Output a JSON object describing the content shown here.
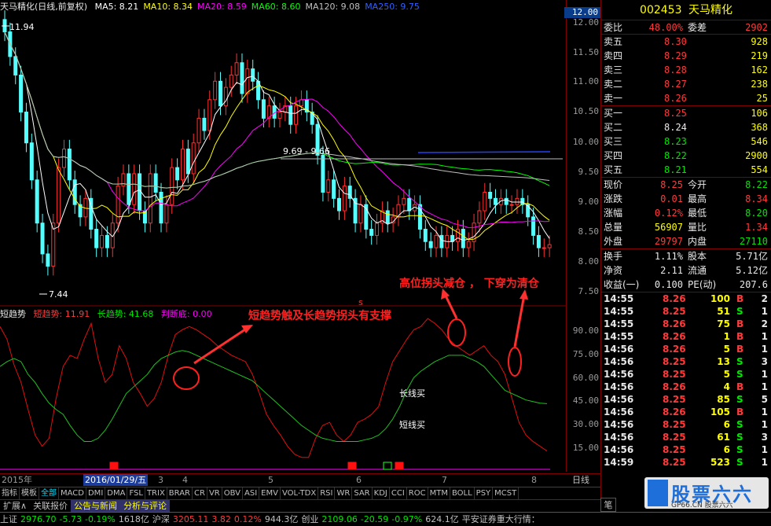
{
  "stock": {
    "code": "002453",
    "name": "天马精化"
  },
  "chart_header": {
    "title": "天马精化(日线,前复权)",
    "ma": [
      {
        "label": "MA5: 8.21",
        "color": "#ffffff"
      },
      {
        "label": "MA10: 8.34",
        "color": "#ffff00"
      },
      {
        "label": "MA20: 8.59",
        "color": "#ff00ff"
      },
      {
        "label": "MA60: 8.60",
        "color": "#00ff00"
      },
      {
        "label": "MA120: 9.08",
        "color": "#c0c0c0"
      },
      {
        "label": "MA250: 9.75",
        "color": "#3060ff"
      }
    ]
  },
  "price_axis": [
    "12.00",
    "11.50",
    "11.00",
    "10.50",
    "10.00",
    "9.50",
    "9.00",
    "8.50",
    "8.00",
    "7.50"
  ],
  "current_price_box": "12.00",
  "price_marks": {
    "high": "11.94",
    "low": "7.44",
    "level": "9.69 - 9.66"
  },
  "indicator_header": {
    "name": "短趋势",
    "short": "短趋势: 11.91",
    "long": "长趋势: 41.68",
    "judge": "判断底: 0.00"
  },
  "indicator_axis": [
    "90.00",
    "75.00",
    "60.00",
    "45.00",
    "30.00",
    "15.00"
  ],
  "annotations": {
    "a1": "短趋势触及长趋势拐头有支撑",
    "a2": "高位拐头减仓 ， 下穿为清仓",
    "long_buy": "长线买",
    "short_buy": "短线买",
    "marker": "s"
  },
  "date_axis": {
    "year": "2015年",
    "selected": "2016/01/29/五",
    "months": [
      "3",
      "4",
      "5",
      "6",
      "7",
      "8"
    ],
    "period": "日线"
  },
  "tabs": [
    "指标",
    "模板",
    "全部",
    "MACD",
    "DMI",
    "DMA",
    "FSL",
    "TRIX",
    "BRAR",
    "CR",
    "VR",
    "OBV",
    "ASI",
    "EMV",
    "VOL-TDX",
    "RSI",
    "WR",
    "SAR",
    "KDJ",
    "CCI",
    "ROC",
    "MTM",
    "BOLL",
    "PSY",
    "MCST"
  ],
  "subtabs": [
    "扩展∧",
    "关联报价",
    "公告与新闻",
    "分析与评论"
  ],
  "order_book": {
    "wb_label": "委比",
    "wb_value": "48.00%",
    "wc_label": "委差",
    "wc_value": "2902",
    "sell": [
      {
        "label": "卖五",
        "price": "8.30",
        "vol": "928"
      },
      {
        "label": "卖四",
        "price": "8.29",
        "vol": "219"
      },
      {
        "label": "卖三",
        "price": "8.28",
        "vol": "162"
      },
      {
        "label": "卖二",
        "price": "8.27",
        "vol": "238"
      },
      {
        "label": "卖一",
        "price": "8.26",
        "vol": "25"
      }
    ],
    "buy": [
      {
        "label": "买一",
        "price": "8.25",
        "vol": "106"
      },
      {
        "label": "买二",
        "price": "8.24",
        "vol": "368"
      },
      {
        "label": "买三",
        "price": "8.23",
        "vol": "546"
      },
      {
        "label": "买四",
        "price": "8.22",
        "vol": "2900"
      },
      {
        "label": "买五",
        "price": "8.21",
        "vol": "554"
      }
    ]
  },
  "quote": [
    {
      "l1": "现价",
      "v1": "8.25",
      "c1": "red",
      "l2": "今开",
      "v2": "8.22",
      "c2": "green"
    },
    {
      "l1": "涨跌",
      "v1": "0.01",
      "c1": "red",
      "l2": "最高",
      "v2": "8.34",
      "c2": "red"
    },
    {
      "l1": "涨幅",
      "v1": "0.12%",
      "c1": "red",
      "l2": "最低",
      "v2": "8.20",
      "c2": "green"
    },
    {
      "l1": "总量",
      "v1": "56907",
      "c1": "yellow",
      "l2": "量比",
      "v2": "1.34",
      "c2": "red"
    },
    {
      "l1": "外盘",
      "v1": "29797",
      "c1": "red",
      "l2": "内盘",
      "v2": "27110",
      "c2": "green"
    }
  ],
  "quote2": [
    {
      "l1": "换手",
      "v1": "1.11%",
      "l2": "股本",
      "v2": "5.71亿"
    },
    {
      "l1": "净资",
      "v1": "2.11",
      "l2": "流通",
      "v2": "5.12亿"
    },
    {
      "l1": "收益(一)",
      "v1": "0.100",
      "l2": "PE(动)",
      "v2": "207.6"
    }
  ],
  "ticks": [
    {
      "t": "14:55",
      "p": "8.26",
      "v": "100",
      "s": "B",
      "n": "2"
    },
    {
      "t": "14:55",
      "p": "8.25",
      "v": "51",
      "s": "S",
      "n": "1"
    },
    {
      "t": "14:55",
      "p": "8.26",
      "v": "75",
      "s": "B",
      "n": "2"
    },
    {
      "t": "14:55",
      "p": "8.26",
      "v": "1",
      "s": "B",
      "n": "1"
    },
    {
      "t": "14:56",
      "p": "8.26",
      "v": "5",
      "s": "B",
      "n": "1"
    },
    {
      "t": "14:56",
      "p": "8.25",
      "v": "13",
      "s": "S",
      "n": "3"
    },
    {
      "t": "14:56",
      "p": "8.25",
      "v": "5",
      "s": "S",
      "n": "1"
    },
    {
      "t": "14:56",
      "p": "8.26",
      "v": "4",
      "s": "B",
      "n": "1"
    },
    {
      "t": "14:56",
      "p": "8.25",
      "v": "85",
      "s": "S",
      "n": "5"
    },
    {
      "t": "14:56",
      "p": "8.26",
      "v": "105",
      "s": "B",
      "n": "1"
    },
    {
      "t": "14:56",
      "p": "8.25",
      "v": "6",
      "s": "S",
      "n": "1"
    },
    {
      "t": "14:56",
      "p": "8.25",
      "v": "61",
      "s": "S",
      "n": "3"
    },
    {
      "t": "14:56",
      "p": "8.25",
      "v": "6",
      "s": "S",
      "n": "1"
    },
    {
      "t": "14:59",
      "p": "8.25",
      "v": "523",
      "s": "S",
      "n": "1"
    }
  ],
  "statusbar": [
    {
      "text": "上证",
      "color": "#c0c0c0"
    },
    {
      "text": "2976.70",
      "color": "#00e600"
    },
    {
      "text": "-5.73",
      "color": "#00e600"
    },
    {
      "text": "-0.19%",
      "color": "#00e600"
    },
    {
      "text": "1618亿",
      "color": "#c0c0c0"
    },
    {
      "text": "沪深",
      "color": "#c0c0c0"
    },
    {
      "text": "3205.11",
      "color": "#ff3a3a"
    },
    {
      "text": "3.82",
      "color": "#ff3a3a"
    },
    {
      "text": "0.12%",
      "color": "#ff3a3a"
    },
    {
      "text": "944.3亿",
      "color": "#c0c0c0"
    },
    {
      "text": "创业",
      "color": "#c0c0c0"
    },
    {
      "text": "2109.06",
      "color": "#00e600"
    },
    {
      "text": "-20.59",
      "color": "#00e600"
    },
    {
      "text": "-0.97%",
      "color": "#00e600"
    },
    {
      "text": "624.1亿",
      "color": "#c0c0c0"
    },
    {
      "text": "平安证券重大行情：",
      "color": "#c0c0c0"
    }
  ],
  "logo": {
    "text": "股票六六",
    "url": "GP66.CN 股票六六"
  },
  "side_tab": "笔"
}
